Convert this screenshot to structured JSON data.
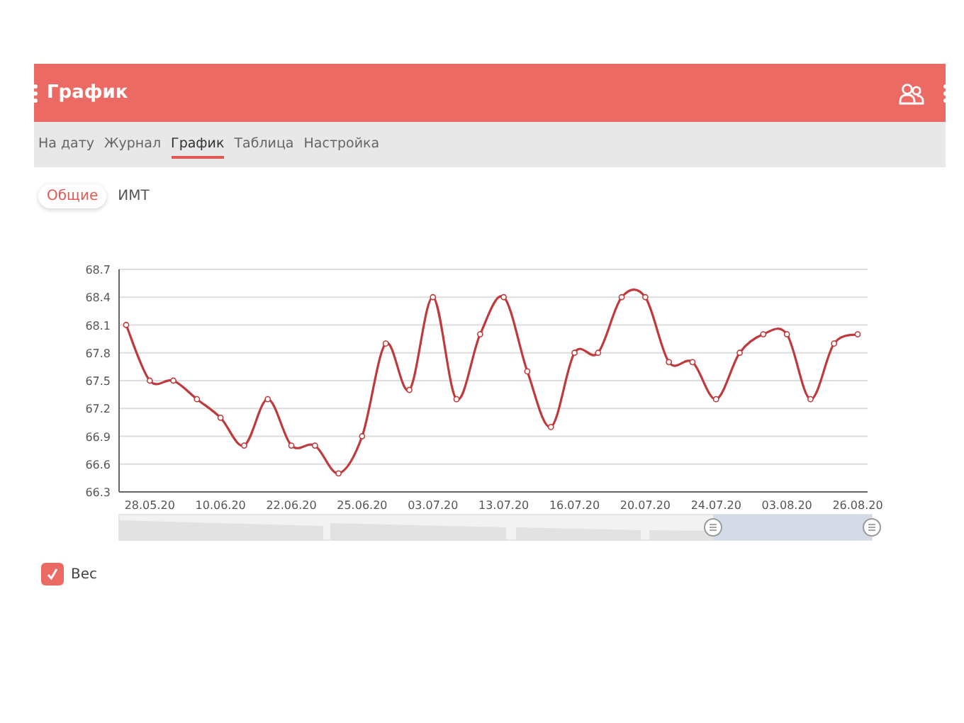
{
  "app_bar": {
    "title": "График"
  },
  "tabs": [
    {
      "label": "На дату",
      "selected": false
    },
    {
      "label": "Журнал",
      "selected": false
    },
    {
      "label": "График",
      "selected": true
    },
    {
      "label": "Таблица",
      "selected": false
    },
    {
      "label": "Настройка",
      "selected": false
    }
  ],
  "subtabs": [
    {
      "label": "Общие",
      "selected": true
    },
    {
      "label": "ИМТ",
      "selected": false
    }
  ],
  "chart": {
    "chart_data": {
      "type": "line",
      "categories": [
        null,
        "28.05.20",
        null,
        null,
        "10.06.20",
        null,
        null,
        "22.06.20",
        null,
        null,
        "25.06.20",
        null,
        null,
        "03.07.20",
        null,
        null,
        "13.07.20",
        null,
        null,
        "16.07.20",
        null,
        null,
        "20.07.20",
        null,
        null,
        "24.07.20",
        null,
        null,
        "03.08.20",
        null,
        null,
        "26.08.20"
      ],
      "ylim": [
        66.3,
        68.7
      ],
      "yticks": [
        {
          "value": 66.3,
          "label": "66.3"
        },
        {
          "value": 66.6,
          "label": "66.6"
        },
        {
          "value": 66.9,
          "label": "66.9"
        },
        {
          "value": 67.2,
          "label": "67.2"
        },
        {
          "value": 67.5,
          "label": "67.5"
        },
        {
          "value": 67.8,
          "label": "67.8"
        },
        {
          "value": 68.1,
          "label": "68.1"
        },
        {
          "value": 68.4,
          "label": "68.4"
        },
        {
          "value": 68.7,
          "label": "68.7"
        }
      ],
      "grid": true,
      "series": [
        {
          "name": "Вес",
          "color": "#c0393b",
          "marker": true,
          "values": [
            68.1,
            67.5,
            67.5,
            67.3,
            67.1,
            66.8,
            67.3,
            66.8,
            66.8,
            66.5,
            66.9,
            67.9,
            67.4,
            68.4,
            67.3,
            68.0,
            68.4,
            67.6,
            67.0,
            67.8,
            67.8,
            68.4,
            68.4,
            67.7,
            67.7,
            67.3,
            67.8,
            68.0,
            68.0,
            67.3,
            67.9,
            68.0
          ]
        }
      ]
    }
  },
  "legend": [
    {
      "checked": true
    }
  ]
}
